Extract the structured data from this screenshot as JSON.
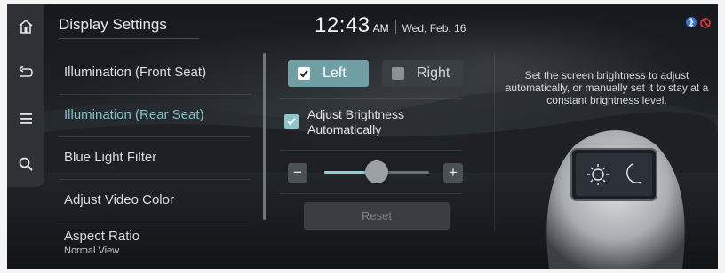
{
  "header": {
    "title": "Display Settings",
    "time": "12:43",
    "ampm": "AM",
    "date": "Wed, Feb. 16"
  },
  "rail": {
    "icons": [
      "home-icon",
      "back-icon",
      "menu-icon",
      "search-icon"
    ]
  },
  "menu": {
    "items": [
      {
        "label": "Illumination (Front Seat)"
      },
      {
        "label": "Illumination (Rear Seat)"
      },
      {
        "label": "Blue Light Filter"
      },
      {
        "label": "Adjust Video Color"
      },
      {
        "label": "Aspect Ratio",
        "sub": "Normal View"
      }
    ],
    "active_index": 1
  },
  "seat_select": {
    "left_label": "Left",
    "right_label": "Right",
    "left_checked": true,
    "right_checked": false
  },
  "auto_brightness": {
    "label_line1": "Adjust Brightness",
    "label_line2": "Automatically",
    "checked": true
  },
  "brightness": {
    "minus": "−",
    "plus": "+",
    "level_fraction": 0.5
  },
  "reset_label": "Reset",
  "description": "Set the screen brightness to adjust automatically, or manually set it to stay at a constant brightness level.",
  "colors": {
    "accent": "#7ec4cc",
    "active_button": "#6f9ea3"
  }
}
